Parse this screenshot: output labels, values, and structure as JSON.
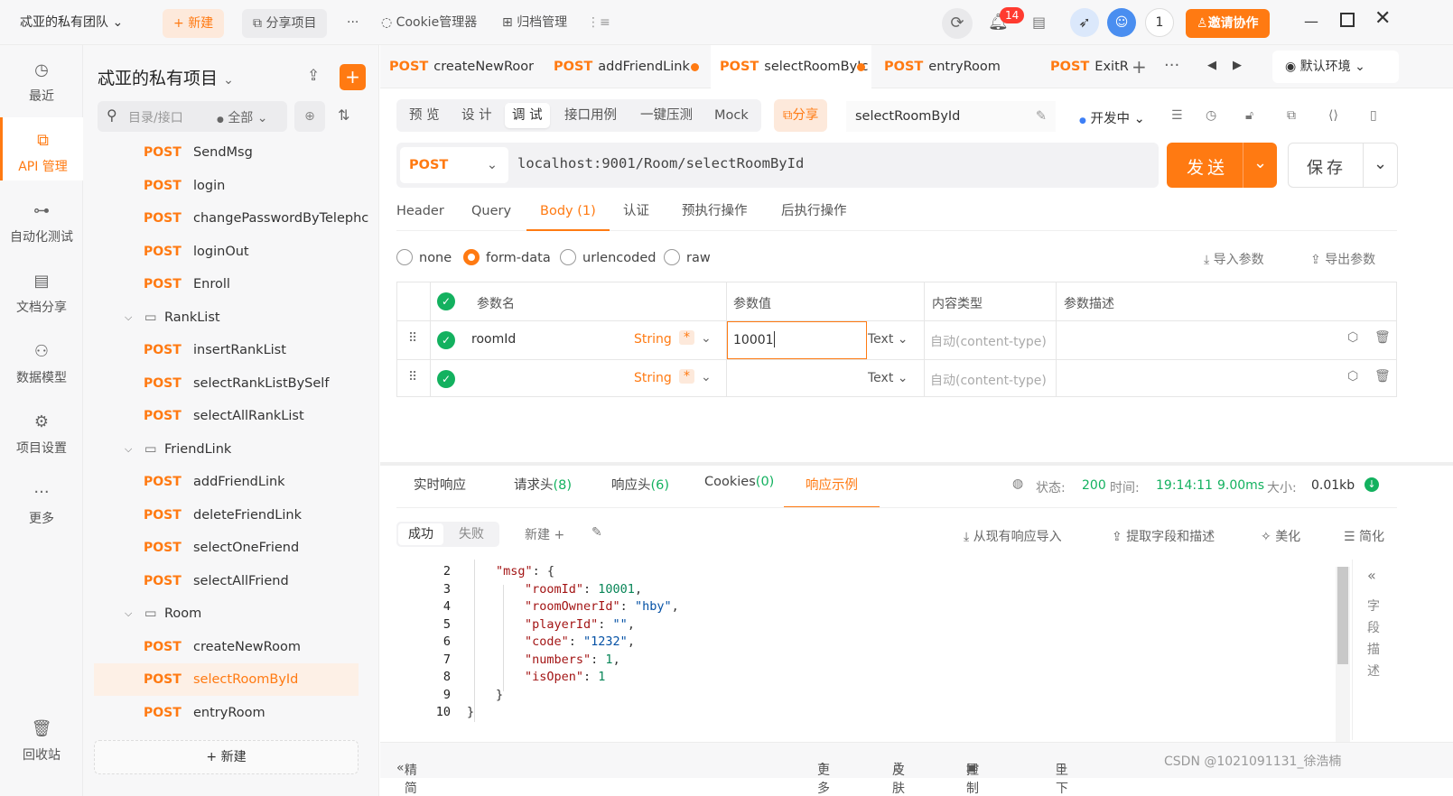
{
  "topbar": {
    "team": "忒亚的私有团队",
    "new_btn": "新建",
    "share_project": "分享项目",
    "more": "···",
    "cookie_mgr": "Cookie管理器",
    "archive_mgr": "归档管理",
    "notif_count": "14",
    "user_count": "1",
    "invite": "邀请协作"
  },
  "rail": {
    "items": [
      {
        "label": "最近",
        "icon": "clock-icon"
      },
      {
        "label": "API 管理",
        "icon": "api-icon"
      },
      {
        "label": "自动化测试",
        "icon": "flow-icon"
      },
      {
        "label": "文档分享",
        "icon": "doc-icon"
      },
      {
        "label": "数据模型",
        "icon": "model-icon"
      },
      {
        "label": "项目设置",
        "icon": "settings-icon"
      },
      {
        "label": "更多",
        "icon": "more-icon"
      },
      {
        "label": "回收站",
        "icon": "trash-icon"
      }
    ]
  },
  "tree": {
    "project": "忒亚的私有项目",
    "search_placeholder": "目录/接口",
    "filter": "全部",
    "new_label": "新建",
    "rows": [
      {
        "kind": "api",
        "method": "POST",
        "name": "SendMsg"
      },
      {
        "kind": "api",
        "method": "POST",
        "name": "login"
      },
      {
        "kind": "api",
        "method": "POST",
        "name": "changePasswordByTelephc"
      },
      {
        "kind": "api",
        "method": "POST",
        "name": "loginOut"
      },
      {
        "kind": "api",
        "method": "POST",
        "name": "Enroll"
      },
      {
        "kind": "folder",
        "name": "RankList"
      },
      {
        "kind": "api",
        "method": "POST",
        "name": "insertRankList"
      },
      {
        "kind": "api",
        "method": "POST",
        "name": "selectRankListBySelf"
      },
      {
        "kind": "api",
        "method": "POST",
        "name": "selectAllRankList"
      },
      {
        "kind": "folder",
        "name": "FriendLink"
      },
      {
        "kind": "api",
        "method": "POST",
        "name": "addFriendLink"
      },
      {
        "kind": "api",
        "method": "POST",
        "name": "deleteFriendLink"
      },
      {
        "kind": "api",
        "method": "POST",
        "name": "selectOneFriend"
      },
      {
        "kind": "api",
        "method": "POST",
        "name": "selectAllFriend"
      },
      {
        "kind": "folder",
        "name": "Room"
      },
      {
        "kind": "api",
        "method": "POST",
        "name": "createNewRoom"
      },
      {
        "kind": "api",
        "method": "POST",
        "name": "selectRoomById",
        "selected": true
      },
      {
        "kind": "api",
        "method": "POST",
        "name": "entryRoom"
      }
    ]
  },
  "tabs": [
    {
      "method": "POST",
      "name": "createNewRoor",
      "dirty": false
    },
    {
      "method": "POST",
      "name": "addFriendLink",
      "dirty": true
    },
    {
      "method": "POST",
      "name": "selectRoomByIc",
      "dirty": true,
      "active": true
    },
    {
      "method": "POST",
      "name": "entryRoom",
      "dirty": false
    },
    {
      "method": "POST",
      "name": "ExitR",
      "dirty": false
    }
  ],
  "env": "默认环境",
  "modes": [
    "预 览",
    "设 计",
    "调 试",
    "接口用例",
    "一键压测",
    "Mock"
  ],
  "share": "分享",
  "api_name": "selectRoomById",
  "status": "开发中",
  "request": {
    "method": "POST",
    "url": "localhost:9001/Room/selectRoomById",
    "send": "发送",
    "save": "保存"
  },
  "subtabs": [
    "Header",
    "Query",
    "Body (1)",
    "认证",
    "预执行操作",
    "后执行操作"
  ],
  "body_types": [
    "none",
    "form-data",
    "urlencoded",
    "raw"
  ],
  "import_params": "导入参数",
  "export_params": "导出参数",
  "params": {
    "headers": [
      "参数名",
      "参数值",
      "内容类型",
      "参数描述"
    ],
    "rows": [
      {
        "name": "roomId",
        "type": "String",
        "value": "10001",
        "ctype": "Text",
        "ctype_ph": "自动(content-type)"
      },
      {
        "name": "",
        "type": "String",
        "value": "",
        "ctype": "Text",
        "ctype_ph": "自动(content-type)"
      }
    ]
  },
  "response": {
    "tabs": [
      "实时响应",
      "请求头",
      "(8)",
      "响应头",
      "(6)",
      "Cookies",
      "(0)",
      "响应示例"
    ],
    "status_label": "状态:",
    "status": "200",
    "time_label": "时间:",
    "time": "19:14:11",
    "duration": "9.00ms",
    "size_label": "大小:",
    "size": "0.01kb",
    "example_tabs": [
      "成功",
      "失败",
      "新建"
    ],
    "actions": [
      "从现有响应导入",
      "提取字段和描述",
      "美化",
      "简化"
    ],
    "side_label": "字段描述",
    "code": [
      {
        "ln": "2",
        "indent": 1,
        "parts": [
          [
            "key",
            "\"msg\""
          ],
          [
            "p",
            ": {"
          ]
        ]
      },
      {
        "ln": "3",
        "indent": 2,
        "parts": [
          [
            "key",
            "\"roomId\""
          ],
          [
            "p",
            ": "
          ],
          [
            "num",
            "10001"
          ],
          [
            "p",
            ","
          ]
        ]
      },
      {
        "ln": "4",
        "indent": 2,
        "parts": [
          [
            "key",
            "\"roomOwnerId\""
          ],
          [
            "p",
            ": "
          ],
          [
            "str",
            "\"hby\""
          ],
          [
            "p",
            ","
          ]
        ]
      },
      {
        "ln": "5",
        "indent": 2,
        "parts": [
          [
            "key",
            "\"playerId\""
          ],
          [
            "p",
            ": "
          ],
          [
            "str",
            "\"\""
          ],
          [
            "p",
            ","
          ]
        ]
      },
      {
        "ln": "6",
        "indent": 2,
        "parts": [
          [
            "key",
            "\"code\""
          ],
          [
            "p",
            ": "
          ],
          [
            "str",
            "\"1232\""
          ],
          [
            "p",
            ","
          ]
        ]
      },
      {
        "ln": "7",
        "indent": 2,
        "parts": [
          [
            "key",
            "\"numbers\""
          ],
          [
            "p",
            ": "
          ],
          [
            "num",
            "1"
          ],
          [
            "p",
            ","
          ]
        ]
      },
      {
        "ln": "8",
        "indent": 2,
        "parts": [
          [
            "key",
            "\"isOpen\""
          ],
          [
            "p",
            ": "
          ],
          [
            "num",
            "1"
          ]
        ]
      },
      {
        "ln": "9",
        "indent": 1,
        "parts": [
          [
            "p",
            "}"
          ]
        ]
      },
      {
        "ln": "10",
        "indent": 0,
        "parts": [
          [
            "p",
            "}"
          ]
        ]
      }
    ]
  },
  "footer": {
    "compact": "精简模式",
    "more": "更多",
    "skin": "皮肤",
    "console": "控制台",
    "split": "上下分屏",
    "watermark": "CSDN @1021091131_徐浩楠"
  },
  "colors": {
    "accent": "#ff7a12",
    "success": "#13b15f",
    "selected_bg": "#fdf0e6"
  }
}
